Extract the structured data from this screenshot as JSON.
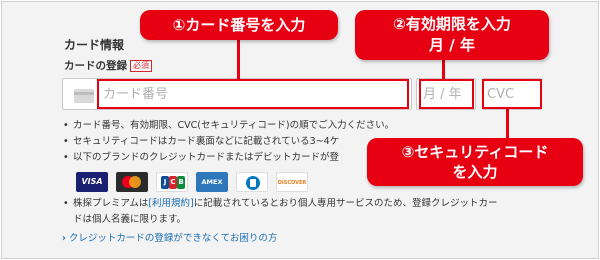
{
  "section": {
    "title": "カード情報",
    "register_label": "カードの登録",
    "required_badge": "必須"
  },
  "form": {
    "card_number_placeholder": "カード番号",
    "expiry_placeholder": "月 / 年",
    "cvc_placeholder": "CVC"
  },
  "notes": [
    "カード番号、有効期限、CVC(セキュリティコード)の順でご入力ください。",
    "セキュリティコードはカード裏面などに記載されている3~4ケ",
    "以下のブランドのクレジットカードまたはデビットカードが登"
  ],
  "brands": {
    "visa": "VISA",
    "jcb_letters": [
      "J",
      "C",
      "B"
    ],
    "amex": "AMEX",
    "discover": "DISCOVER"
  },
  "notes2": {
    "prefix": "株探プレミアムは",
    "link": "[利用規約]",
    "suffix": "に記載されているとおり個人専用サービスのため、登録クレジットカー",
    "line2": "ドは個人名義に限ります。"
  },
  "help_link": "クレジットカードの登録ができなくてお困りの方",
  "callouts": {
    "card": "①カード番号を入力",
    "expiry_line1": "②有効期限を入力",
    "expiry_line2": "月 / 年",
    "cvc_line1": "③セキュリティコード",
    "cvc_line2": "を入力"
  },
  "colors": {
    "accent_red": "#e60012",
    "link_blue": "#1a6fb5"
  }
}
